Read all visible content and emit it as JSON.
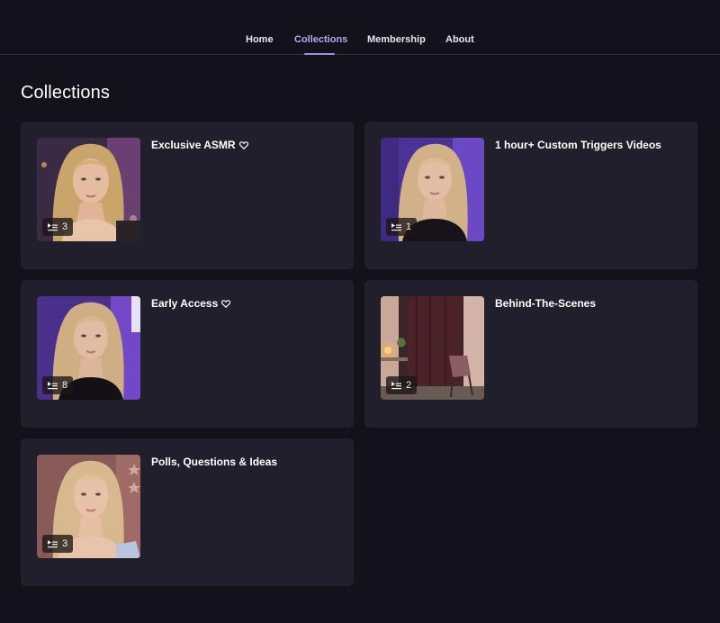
{
  "nav": {
    "tabs": [
      {
        "label": "Home",
        "active": false
      },
      {
        "label": "Collections",
        "active": true
      },
      {
        "label": "Membership",
        "active": false
      },
      {
        "label": "About",
        "active": false
      }
    ]
  },
  "page": {
    "title": "Collections"
  },
  "collections": [
    {
      "title": "Exclusive ASMR",
      "count": "3",
      "heart": true,
      "thumb": "portrait-purple-lights"
    },
    {
      "title": "1 hour+ Custom Triggers Videos",
      "count": "1",
      "heart": false,
      "thumb": "portrait-purple"
    },
    {
      "title": "Early Access",
      "count": "8",
      "heart": true,
      "thumb": "portrait-purple"
    },
    {
      "title": "Behind-The-Scenes",
      "count": "2",
      "heart": false,
      "thumb": "room-interior"
    },
    {
      "title": "Polls, Questions & Ideas",
      "count": "3",
      "heart": false,
      "thumb": "portrait-pink-stars"
    }
  ],
  "colors": {
    "background": "#13121a",
    "card": "#201f2b",
    "accent": "#b7a8f0"
  }
}
